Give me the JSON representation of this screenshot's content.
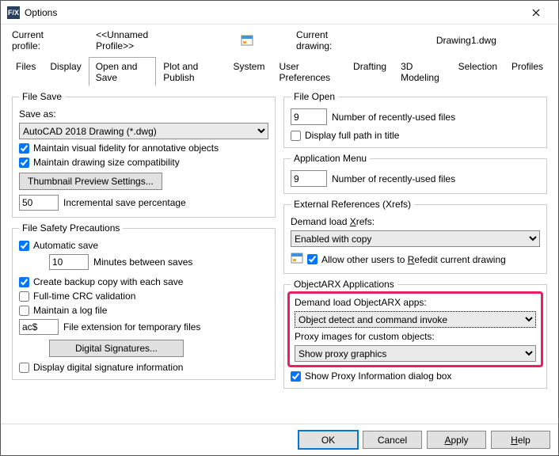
{
  "title": "Options",
  "profile": {
    "label": "Current profile:",
    "value": "<<Unnamed Profile>>"
  },
  "drawing": {
    "label": "Current drawing:",
    "value": "Drawing1.dwg"
  },
  "tabs": [
    "Files",
    "Display",
    "Open and Save",
    "Plot and Publish",
    "System",
    "User Preferences",
    "Drafting",
    "3D Modeling",
    "Selection",
    "Profiles"
  ],
  "active_tab": "Open and Save",
  "file_save": {
    "legend": "File Save",
    "save_as_label": "Save as:",
    "save_as_value": "AutoCAD 2018 Drawing (*.dwg)",
    "maintain_visual": "Maintain visual fidelity for annotative objects",
    "maintain_compat": "Maintain drawing size compatibility",
    "thumb_btn": "Thumbnail Preview Settings...",
    "inc_value": "50",
    "inc_label": "Incremental save percentage"
  },
  "file_safety": {
    "legend": "File Safety Precautions",
    "auto_save": "Automatic save",
    "minutes_value": "10",
    "minutes_label": "Minutes between saves",
    "backup": "Create backup copy with each save",
    "crc": "Full-time CRC validation",
    "logfile": "Maintain a log file",
    "ext_value": "ac$",
    "ext_label": "File extension for temporary files",
    "sig_btn": "Digital Signatures...",
    "disp_sig": "Display digital signature information"
  },
  "file_open": {
    "legend": "File Open",
    "num_value": "9",
    "num_label": "Number of recently-used files",
    "full_path": "Display full path in title"
  },
  "app_menu": {
    "legend": "Application Menu",
    "num_value": "9",
    "num_label": "Number of recently-used files"
  },
  "xrefs": {
    "legend": "External References (Xrefs)",
    "demand_label": "Demand load Xrefs:",
    "demand_value": "Enabled with copy",
    "allow_label": "Allow other users to Refedit current drawing"
  },
  "objectarx": {
    "legend": "ObjectARX Applications",
    "demand_label": "Demand load ObjectARX apps:",
    "demand_value": "Object detect and command invoke",
    "proxy_label": "Proxy images for custom objects:",
    "proxy_value": "Show proxy graphics",
    "show_proxy_dlg": "Show Proxy Information dialog box"
  },
  "buttons": {
    "ok": "OK",
    "cancel": "Cancel",
    "apply": "Apply",
    "help": "Help"
  }
}
